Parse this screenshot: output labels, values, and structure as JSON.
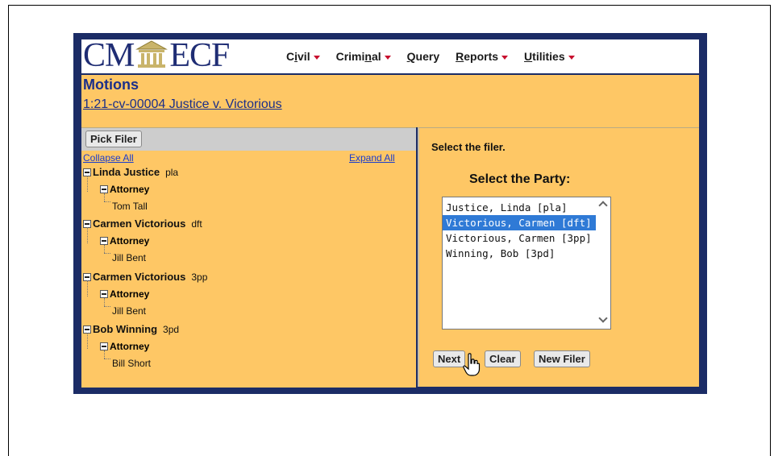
{
  "app": {
    "logo_left": "CM",
    "logo_right": "ECF",
    "menus": [
      {
        "label_pre": "C",
        "label_u": "i",
        "label_post": "vil",
        "has_caret": true
      },
      {
        "label_pre": "Crimi",
        "label_u": "n",
        "label_post": "al",
        "has_caret": true
      },
      {
        "label_pre": "",
        "label_u": "Q",
        "label_post": "uery",
        "has_caret": false
      },
      {
        "label_pre": "",
        "label_u": "R",
        "label_post": "eports",
        "has_caret": true
      },
      {
        "label_pre": "",
        "label_u": "U",
        "label_post": "tilities",
        "has_caret": true
      }
    ]
  },
  "header": {
    "title": "Motions",
    "case_link": "1:21-cv-00004 Justice v. Victorious"
  },
  "left_panel": {
    "pick_filer_label": "Pick Filer",
    "collapse_all": "Collapse All",
    "expand_all": "Expand All",
    "parties": [
      {
        "name": "Linda Justice",
        "role": "pla",
        "attorney_label": "Attorney",
        "attorney": "Tom Tall"
      },
      {
        "name": "Carmen Victorious",
        "role": "dft",
        "attorney_label": "Attorney",
        "attorney": "Jill Bent"
      },
      {
        "name": "Carmen Victorious",
        "role": "3pp",
        "attorney_label": "Attorney",
        "attorney": "Jill Bent"
      },
      {
        "name": "Bob Winning",
        "role": "3pd",
        "attorney_label": "Attorney",
        "attorney": "Bill Short"
      }
    ]
  },
  "right_panel": {
    "instruction": "Select the filer.",
    "select_label": "Select the Party:",
    "options": [
      {
        "text": "Justice, Linda [pla]",
        "selected": false
      },
      {
        "text": "Victorious, Carmen [dft]",
        "selected": true
      },
      {
        "text": "Victorious, Carmen [3pp]",
        "selected": false
      },
      {
        "text": "Winning, Bob [3pd]",
        "selected": false
      }
    ],
    "buttons": {
      "next": "Next",
      "clear": "Clear",
      "new_filer": "New Filer"
    }
  },
  "colors": {
    "navy": "#1b2c66",
    "panel": "#fec765",
    "selected": "#2f7ad6",
    "caret": "#c8102e"
  }
}
